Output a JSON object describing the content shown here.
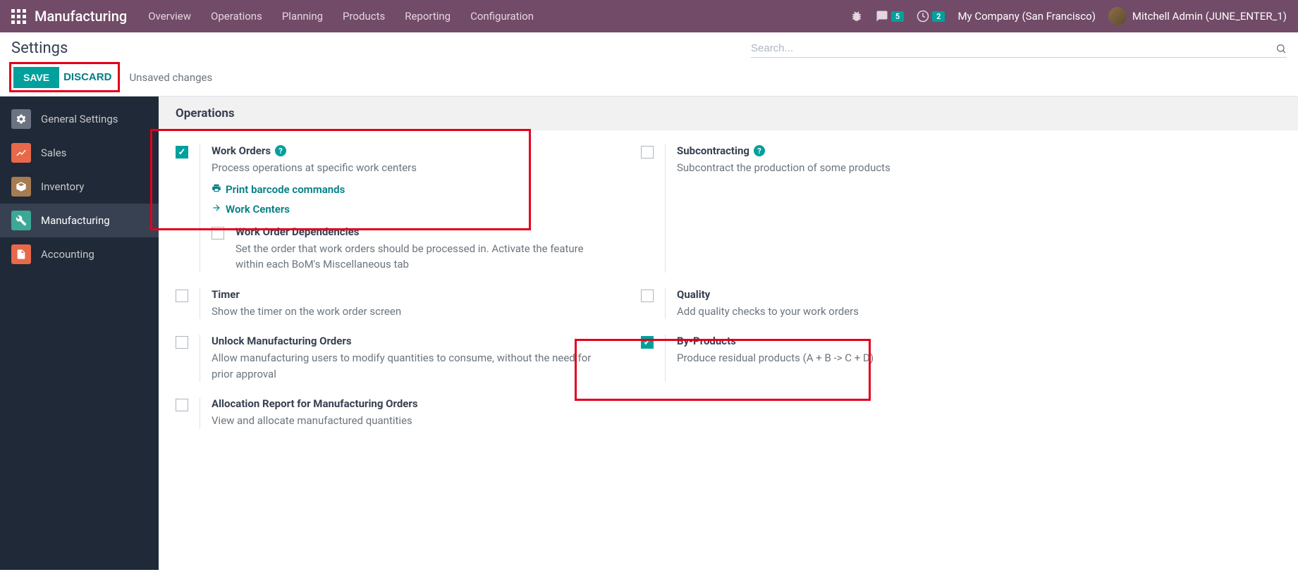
{
  "navbar": {
    "brand": "Manufacturing",
    "menu": [
      "Overview",
      "Operations",
      "Planning",
      "Products",
      "Reporting",
      "Configuration"
    ],
    "messages_count": "5",
    "activities_count": "2",
    "company": "My Company (San Francisco)",
    "user": "Mitchell Admin (JUNE_ENTER_1)"
  },
  "control": {
    "title": "Settings",
    "save": "SAVE",
    "discard": "DISCARD",
    "status": "Unsaved changes",
    "search_placeholder": "Search..."
  },
  "sidebar": {
    "items": [
      {
        "label": "General Settings"
      },
      {
        "label": "Sales"
      },
      {
        "label": "Inventory"
      },
      {
        "label": "Manufacturing"
      },
      {
        "label": "Accounting"
      }
    ],
    "active_index": 3
  },
  "section": {
    "title": "Operations",
    "settings": {
      "work_orders": {
        "title": "Work Orders",
        "desc": "Process operations at specific work centers",
        "checked": true,
        "link1": "Print barcode commands",
        "link2": "Work Centers"
      },
      "subcontracting": {
        "title": "Subcontracting",
        "desc": "Subcontract the production of some products",
        "checked": false
      },
      "wo_deps": {
        "title": "Work Order Dependencies",
        "desc": "Set the order that work orders should be processed in. Activate the feature within each BoM's Miscellaneous tab",
        "checked": false
      },
      "timer": {
        "title": "Timer",
        "desc": "Show the timer on the work order screen",
        "checked": false
      },
      "quality": {
        "title": "Quality",
        "desc": "Add quality checks to your work orders",
        "checked": false
      },
      "unlock": {
        "title": "Unlock Manufacturing Orders",
        "desc": "Allow manufacturing users to modify quantities to consume, without the need for prior approval",
        "checked": false
      },
      "byproducts": {
        "title": "By-Products",
        "desc": "Produce residual products (A + B -> C + D)",
        "checked": true
      },
      "allocation": {
        "title": "Allocation Report for Manufacturing Orders",
        "desc": "View and allocate manufactured quantities",
        "checked": false
      }
    }
  }
}
